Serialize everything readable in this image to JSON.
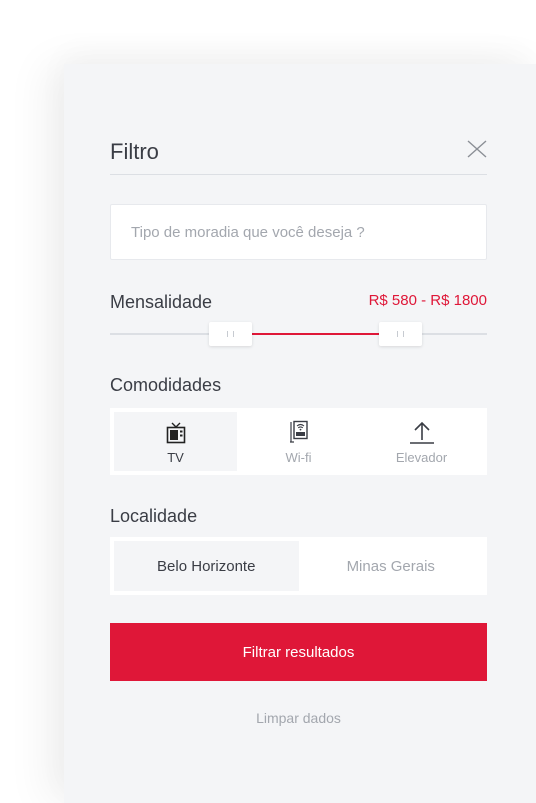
{
  "filter": {
    "title": "Filtro",
    "search_placeholder": "Tipo de moradia que você deseja ?",
    "price": {
      "label": "Mensalidade",
      "range_text": "R$ 580 - R$ 1800",
      "slider_min_fraction": 0.32,
      "slider_max_fraction": 0.77
    },
    "amenities": {
      "label": "Comodidades",
      "items": [
        {
          "label": "TV",
          "icon": "tv-icon",
          "selected": true
        },
        {
          "label": "Wi-fi",
          "icon": "wifi-router-icon",
          "selected": false
        },
        {
          "label": "Elevador",
          "icon": "upload-arrow-icon",
          "selected": false
        }
      ]
    },
    "location": {
      "label": "Localidade",
      "items": [
        {
          "label": "Belo Horizonte",
          "selected": true
        },
        {
          "label": "Minas Gerais",
          "selected": false
        }
      ]
    },
    "submit_label": "Filtrar resultados",
    "clear_label": "Limpar dados"
  },
  "colors": {
    "accent": "#df1738",
    "panel_bg": "#f4f5f7",
    "text": "#3a3d45",
    "muted": "#a3a7ae"
  }
}
